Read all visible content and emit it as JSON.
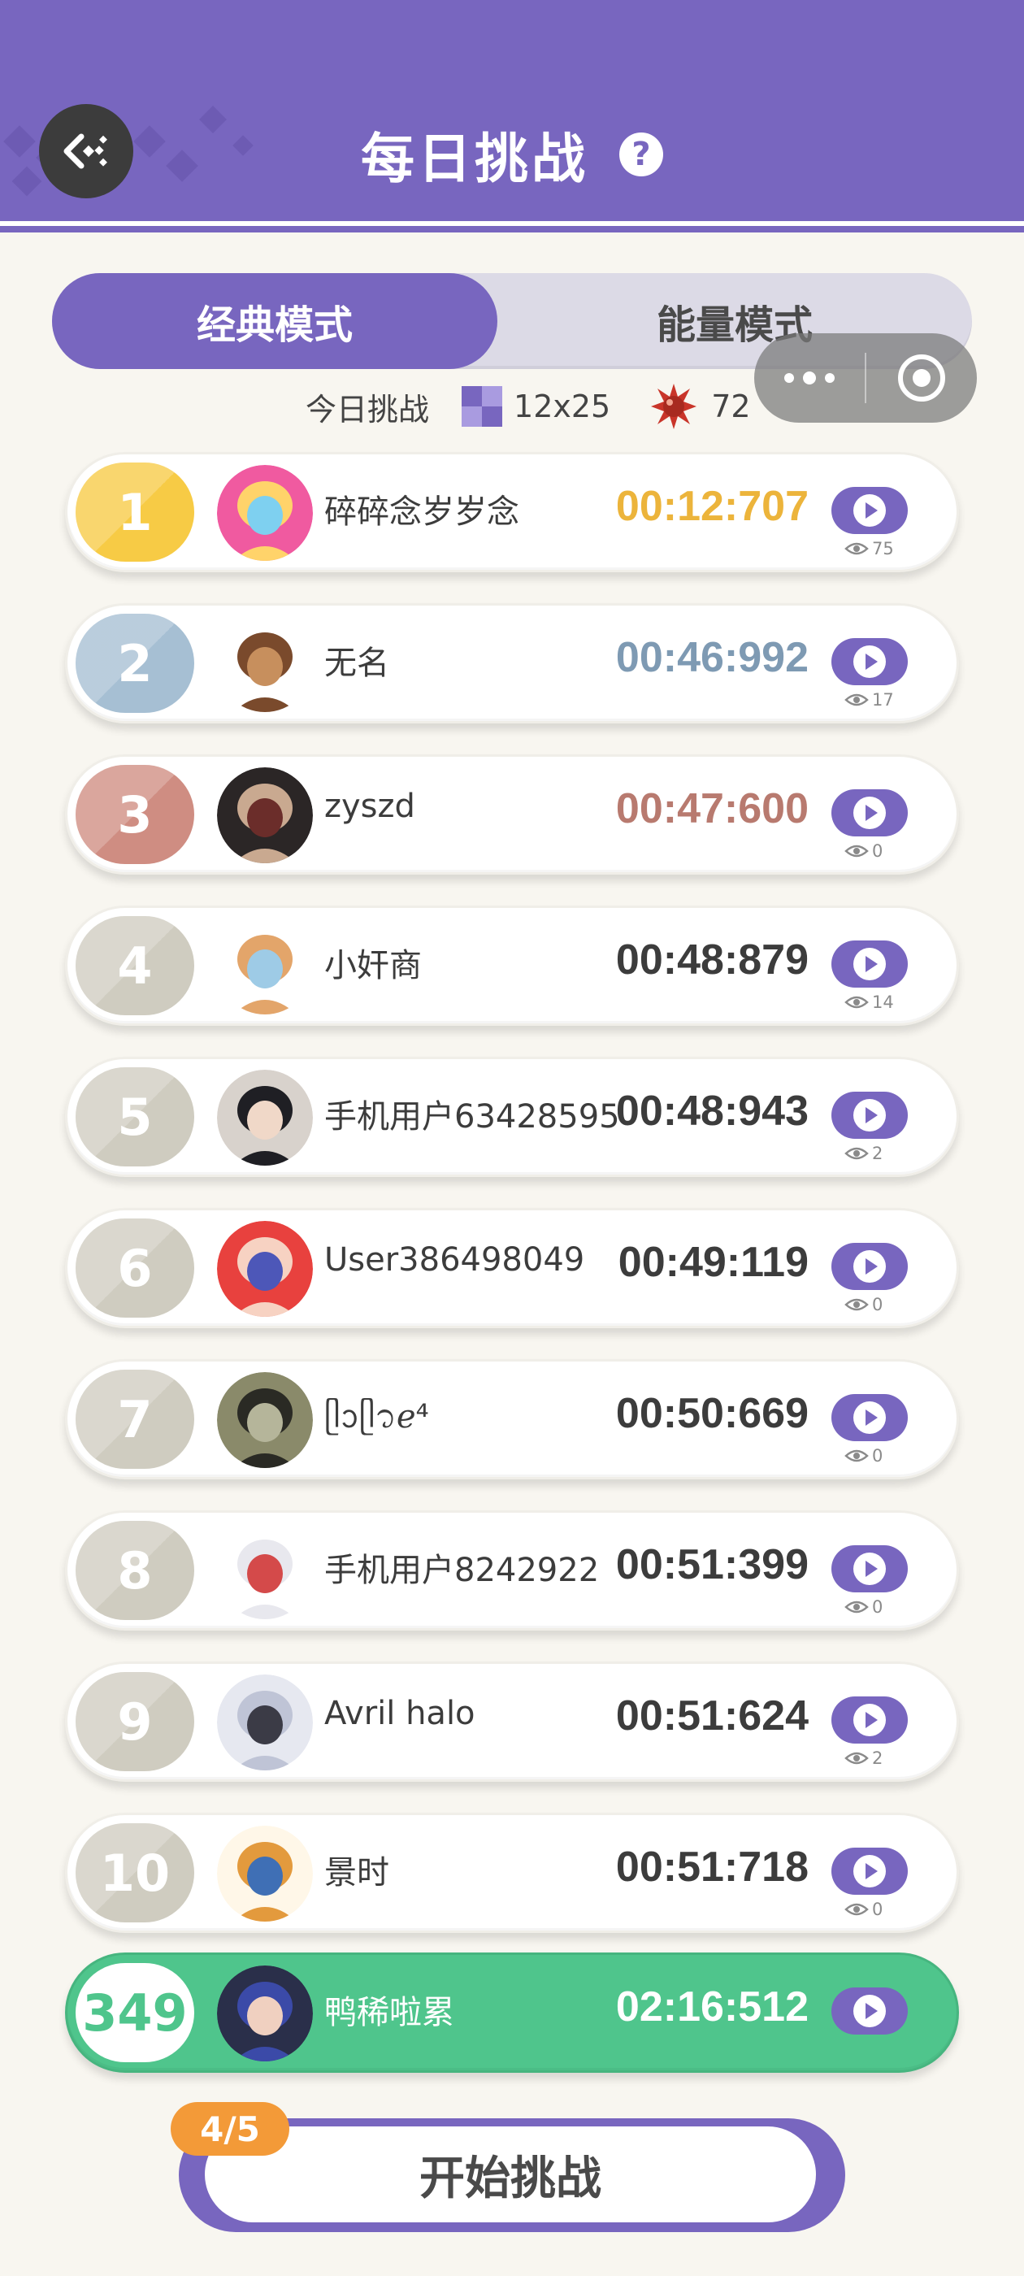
{
  "header": {
    "title": "每日挑战",
    "help_symbol": "?",
    "background_color": "#7866bf"
  },
  "tabs": [
    {
      "label": "经典模式",
      "active": true
    },
    {
      "label": "能量模式",
      "active": false
    }
  ],
  "today": {
    "label": "今日挑战",
    "grid_size": "12x25",
    "mine_count": "72"
  },
  "rank_colors": {
    "gold": "#f7cb45",
    "silver": "#a6bfd3",
    "bronze": "#cf8d82",
    "default": "#cfccc0",
    "me": "#ffffff"
  },
  "rankings": [
    {
      "rank": "1",
      "name": "碎碎念岁岁念",
      "time": "00:12:707",
      "views": "75",
      "medal": "gold",
      "time_color": "#ecb43b",
      "avatar": "anime-girl-avatar"
    },
    {
      "rank": "2",
      "name": "无名",
      "time": "00:46:992",
      "views": "17",
      "medal": "silver",
      "time_color": "#7e9ab3",
      "avatar": "fan-figure-avatar"
    },
    {
      "rank": "3",
      "name": "zyszd",
      "time": "00:47:600",
      "views": "0",
      "medal": "bronze",
      "time_color": "#b87a6f",
      "avatar": "doll-avatar"
    },
    {
      "rank": "4",
      "name": "小奸商",
      "time": "00:48:879",
      "views": "14",
      "medal": "default",
      "time_color": "#3c3c3c",
      "avatar": "chibi-boy-avatar"
    },
    {
      "rank": "5",
      "name": "手机用户63428595",
      "time": "00:48:943",
      "views": "2",
      "medal": "default",
      "time_color": "#3c3c3c",
      "avatar": "dark-hair-man-avatar"
    },
    {
      "rank": "6",
      "name": "User386498049",
      "time": "00:49:119",
      "views": "0",
      "medal": "default",
      "time_color": "#3c3c3c",
      "avatar": "red-hair-girl-avatar"
    },
    {
      "rank": "7",
      "name": "ᥫᩣᥫ᭡ℯ⁴",
      "time": "00:50:669",
      "views": "0",
      "medal": "default",
      "time_color": "#3c3c3c",
      "avatar": "landscape-avatar"
    },
    {
      "rank": "8",
      "name": "手机用户8242922",
      "time": "00:51:399",
      "views": "0",
      "medal": "default",
      "time_color": "#3c3c3c",
      "avatar": "fox-girl-avatar"
    },
    {
      "rank": "9",
      "name": "Avril halo",
      "time": "00:51:624",
      "views": "2",
      "medal": "default",
      "time_color": "#3c3c3c",
      "avatar": "white-hair-avatar"
    },
    {
      "rank": "10",
      "name": "景时",
      "time": "00:51:718",
      "views": "0",
      "medal": "default",
      "time_color": "#3c3c3c",
      "avatar": "shiba-dog-avatar"
    }
  ],
  "my_rank": {
    "rank": "349",
    "name": "鸭稀啦累",
    "time": "02:16:512",
    "row_color": "#4fc58c",
    "avatar": "blue-hair-boy-avatar"
  },
  "start": {
    "label": "开始挑战",
    "attempts": "4/5"
  }
}
